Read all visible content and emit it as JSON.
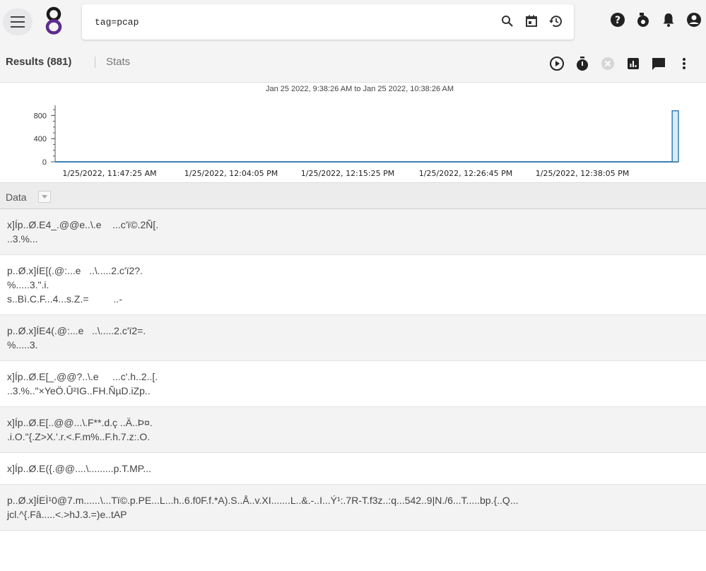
{
  "search": {
    "query": "tag=pcap"
  },
  "icons": {
    "menu": "hamburger-menu-icon",
    "logo": "gravwell-logo-icon",
    "search": "search-icon",
    "calendar": "calendar-icon",
    "history": "history-icon",
    "help": "help-icon",
    "kit": "kit-icon",
    "notifications": "bell-icon",
    "account": "account-icon"
  },
  "tabs": {
    "results": "Results (881)",
    "stats": "Stats"
  },
  "chart_data": {
    "type": "bar",
    "title": "Jan 25 2022, 9:38:26 AM to Jan 25 2022, 10:38:26 AM",
    "y_ticks": [
      "800",
      "400",
      "0"
    ],
    "ylim": [
      0,
      1000
    ],
    "x_ticks": [
      "1/25/2022, 11:47:25 AM",
      "1/25/2022, 12:04:05 PM",
      "1/25/2022, 12:15:25 PM",
      "1/25/2022, 12:26:45 PM",
      "1/25/2022, 12:38:05 PM"
    ],
    "series": [
      {
        "values": [
          0,
          0,
          0,
          0,
          0,
          0,
          0,
          0,
          0,
          0,
          0,
          0,
          0,
          0,
          0,
          0,
          0,
          0,
          0,
          0,
          0,
          0,
          0,
          0,
          0,
          0,
          0,
          0,
          0,
          0,
          0,
          0,
          0,
          0,
          0,
          0,
          0,
          0,
          0,
          0,
          0,
          0,
          0,
          0,
          0,
          0,
          0,
          0,
          0,
          0,
          0,
          0,
          0,
          0,
          0,
          0,
          0,
          0,
          0,
          0,
          0,
          0,
          0,
          0,
          0,
          0,
          0,
          0,
          0,
          0,
          0,
          0,
          0,
          0,
          0,
          0,
          0,
          0,
          0,
          0,
          0,
          0,
          0,
          0,
          0,
          0,
          0,
          0,
          0,
          0,
          0,
          0,
          0,
          0,
          0,
          0,
          0,
          0,
          0,
          881
        ]
      }
    ],
    "grid": false,
    "bar_color": "#3a7fb8",
    "bar_fill": "#d8ecf6"
  },
  "data_column": {
    "label": "Data"
  },
  "rows": [
    {
      "lines": [
        "x]Íp..Ø.E4_.@@e..\\.e    ...c'ï©.2Ñ[.",
        "..3.%..."
      ]
    },
    {
      "lines": [
        "p..Ø.x]ÍE[(.@:...e   ..\\.....2.c'ï2?.",
        "%.....3.\".i.",
        "s..Bì.C.F...4...s.Z.=         ..-"
      ]
    },
    {
      "lines": [
        "p..Ø.x]ÍE4(.@:...e   ..\\.....2.c'ï2=.",
        "%.....3."
      ]
    },
    {
      "lines": [
        "x]Íp..Ø.E[_.@@?..\\.e     ...c'.h..2..[.",
        "..3.%..\"×YeÖ.Û²IG..FH.ÑµD.iZp.."
      ]
    },
    {
      "lines": [
        "x]Íp..Ø.E[..@@...\\.F**.d.ç ..Ä..Þ¤.",
        ".i.O.\"{.Z>X.'.r.<.F.m%..F.h.7.z:.O."
      ]
    },
    {
      "lines": [
        "x]Íp..Ø.E({.@@....\\.........p.T.MP..."
      ]
    },
    {
      "lines": [
        "p..Ø.x]ÍEÌ¹0@7.m......\\...Tï©.p.PE...L...h..6.f0F.f.*A).S..Å..v.XI.......L..&.-..I...Ý¹:.7R-T.f3z..:q...542..9|N./6...T.....bp.{..Q...",
        "jcl.^{.Fâ.....<.>hJ.3.=)e..tAP"
      ]
    }
  ],
  "colors": {
    "accent": "#5b2d8e",
    "bar": "#3a7fb8"
  }
}
